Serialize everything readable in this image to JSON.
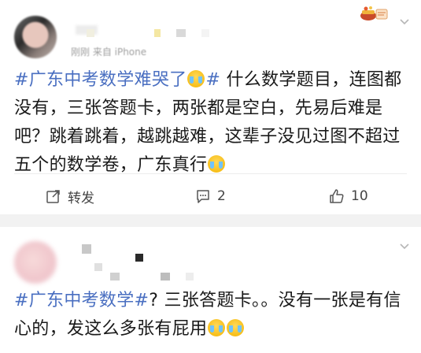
{
  "post1": {
    "time_source": "刚刚  来自 iPhone",
    "text_parts": [
      {
        "kind": "tag",
        "text": "#广东中考数学难哭了"
      },
      {
        "kind": "emoji",
        "name": "crying-emoji"
      },
      {
        "kind": "tag",
        "text": "#"
      },
      {
        "kind": "text",
        "text": " 什么数学题目，连图都没有，三张答题卡，两张都是空白，先易后难是吧？跳着跳着，越跳越难，这辈子没见过图不超过五个的数学卷，广东真行"
      },
      {
        "kind": "emoji",
        "name": "crying-emoji"
      }
    ],
    "actions": {
      "repost_label": "转发",
      "comment_count": "2",
      "like_count": "10"
    }
  },
  "post2": {
    "text_parts": [
      {
        "kind": "tag",
        "text": "#广东中考数学#"
      },
      {
        "kind": "text",
        "text": "? 三张答题卡。。没有一张是有信心的，发这么多张有屁用"
      },
      {
        "kind": "emoji",
        "name": "crying-emoji"
      },
      {
        "kind": "emoji",
        "name": "crying-emoji"
      }
    ]
  },
  "colors": {
    "hashtag": "#4a6fc1",
    "text": "#1a1a1a",
    "meta": "#a0a0a0",
    "background": "#f2f2f2"
  }
}
